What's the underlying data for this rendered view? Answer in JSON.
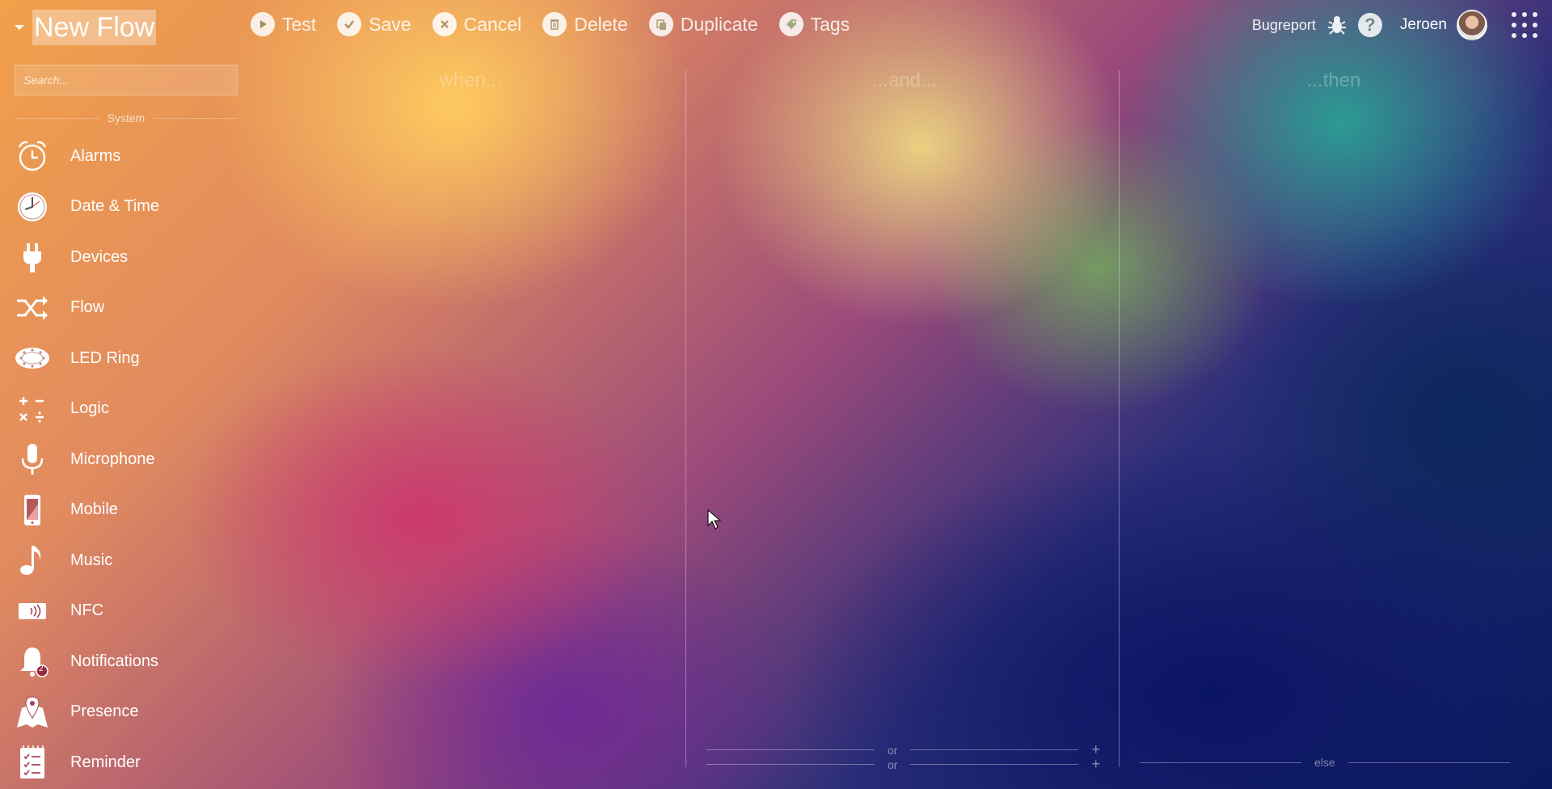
{
  "header": {
    "flow_title": "New Flow",
    "toolbar": [
      {
        "label": "Test",
        "icon": "play-icon"
      },
      {
        "label": "Save",
        "icon": "check-icon"
      },
      {
        "label": "Cancel",
        "icon": "cancel-icon"
      },
      {
        "label": "Delete",
        "icon": "trash-icon"
      },
      {
        "label": "Duplicate",
        "icon": "duplicate-icon"
      },
      {
        "label": "Tags",
        "icon": "tag-icon"
      }
    ],
    "bugreport_label": "Bugreport",
    "help_label": "?",
    "username": "Jeroen"
  },
  "sidebar": {
    "search_placeholder": "Search...",
    "section_label": "System",
    "items": [
      {
        "label": "Alarms",
        "icon": "alarm-clock-icon"
      },
      {
        "label": "Date & Time",
        "icon": "clock-icon"
      },
      {
        "label": "Devices",
        "icon": "plug-icon"
      },
      {
        "label": "Flow",
        "icon": "shuffle-icon"
      },
      {
        "label": "LED Ring",
        "icon": "led-ring-icon"
      },
      {
        "label": "Logic",
        "icon": "math-icon"
      },
      {
        "label": "Microphone",
        "icon": "microphone-icon"
      },
      {
        "label": "Mobile",
        "icon": "mobile-icon"
      },
      {
        "label": "Music",
        "icon": "music-note-icon"
      },
      {
        "label": "NFC",
        "icon": "nfc-icon"
      },
      {
        "label": "Notifications",
        "icon": "bell-icon",
        "badge": "2"
      },
      {
        "label": "Presence",
        "icon": "map-pin-icon"
      },
      {
        "label": "Reminder",
        "icon": "checklist-icon"
      }
    ]
  },
  "canvas": {
    "columns": [
      "when...",
      "...and...",
      "...then"
    ],
    "or_label": "or",
    "else_label": "else",
    "plus_label": "+"
  },
  "colors": {
    "toolbar_text": "#ffffff",
    "help_icon_text": "#6c8d8a"
  }
}
